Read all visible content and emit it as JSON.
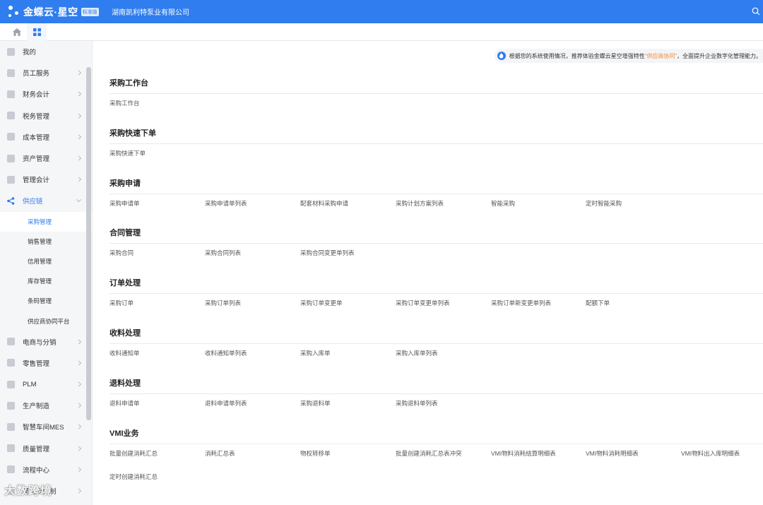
{
  "header": {
    "logo_text": "金蝶云·星空",
    "logo_badge": "标准版",
    "company": "湖南凯利特泵业有限公司"
  },
  "sidebar": {
    "items": [
      {
        "label": "我的",
        "icon": "user-icon",
        "chevron": false
      },
      {
        "label": "员工服务",
        "icon": "employee-icon",
        "chevron": true
      },
      {
        "label": "财务会计",
        "icon": "finance-icon",
        "chevron": true
      },
      {
        "label": "税务管理",
        "icon": "tax-icon",
        "chevron": true
      },
      {
        "label": "成本管理",
        "icon": "cost-icon",
        "chevron": true
      },
      {
        "label": "资产管理",
        "icon": "asset-icon",
        "chevron": true
      },
      {
        "label": "管理会计",
        "icon": "accounting-icon",
        "chevron": true
      },
      {
        "label": "供应链",
        "icon": "supply-chain-icon",
        "chevron": true,
        "expanded": true
      }
    ],
    "sub_items": [
      "采购管理",
      "销售管理",
      "信用管理",
      "库存管理",
      "条码管理",
      "供应商协同平台"
    ],
    "items_after": [
      {
        "label": "电商与分销",
        "icon": "ecommerce-icon"
      },
      {
        "label": "零售管理",
        "icon": "retail-icon"
      },
      {
        "label": "PLM",
        "icon": "plm-icon"
      },
      {
        "label": "生产制造",
        "icon": "manufacturing-icon"
      },
      {
        "label": "智慧车间MES",
        "icon": "mes-icon"
      },
      {
        "label": "质量管理",
        "icon": "quality-icon"
      },
      {
        "label": "流程中心",
        "icon": "process-icon"
      },
      {
        "label": "星空云限制",
        "icon": "cloud-icon"
      }
    ]
  },
  "notice": {
    "prefix": "根据您的系统使用情况，推荐体验金蝶云星空增强特性",
    "highlight": "“供应商协同”",
    "suffix": "，全面提升企业数字化管理能力。"
  },
  "sections": [
    {
      "title": "采购工作台",
      "links": [
        "采购工作台"
      ]
    },
    {
      "title": "采购快速下单",
      "links": [
        "采购快速下单"
      ]
    },
    {
      "title": "采购申请",
      "links": [
        "采购申请单",
        "采购申请单列表",
        "配套材料采购申请",
        "采购计划方案列表",
        "智能采购",
        "定时智能采购"
      ]
    },
    {
      "title": "合同管理",
      "links": [
        "采购合同",
        "采购合同列表",
        "采购合同变更单列表"
      ]
    },
    {
      "title": "订单处理",
      "links": [
        "采购订单",
        "采购订单列表",
        "采购订单变更单",
        "采购订单变更单列表",
        "采购订单新变更单列表",
        "配额下单"
      ]
    },
    {
      "title": "收料处理",
      "links": [
        "收料通知单",
        "收料通知单列表",
        "采购入库单",
        "采购入库单列表"
      ]
    },
    {
      "title": "退料处理",
      "links": [
        "退料申请单",
        "退料申请单列表",
        "采购退料单",
        "采购退料单列表"
      ]
    },
    {
      "title": "VMI业务",
      "links": [
        "批量创建消耗汇总",
        "消耗汇总表",
        "物权转移单",
        "批量创建消耗汇总表冲突",
        "VMI物料消耗结算明细表",
        "VMI物料消耗明细表",
        "VMI物料出入库明细表"
      ],
      "links_row2": [
        "定时创建消耗汇总"
      ]
    }
  ],
  "watermark": "大数跨境",
  "colors": {
    "brand": "#2f7dee",
    "highlight": "#f08c3c"
  }
}
